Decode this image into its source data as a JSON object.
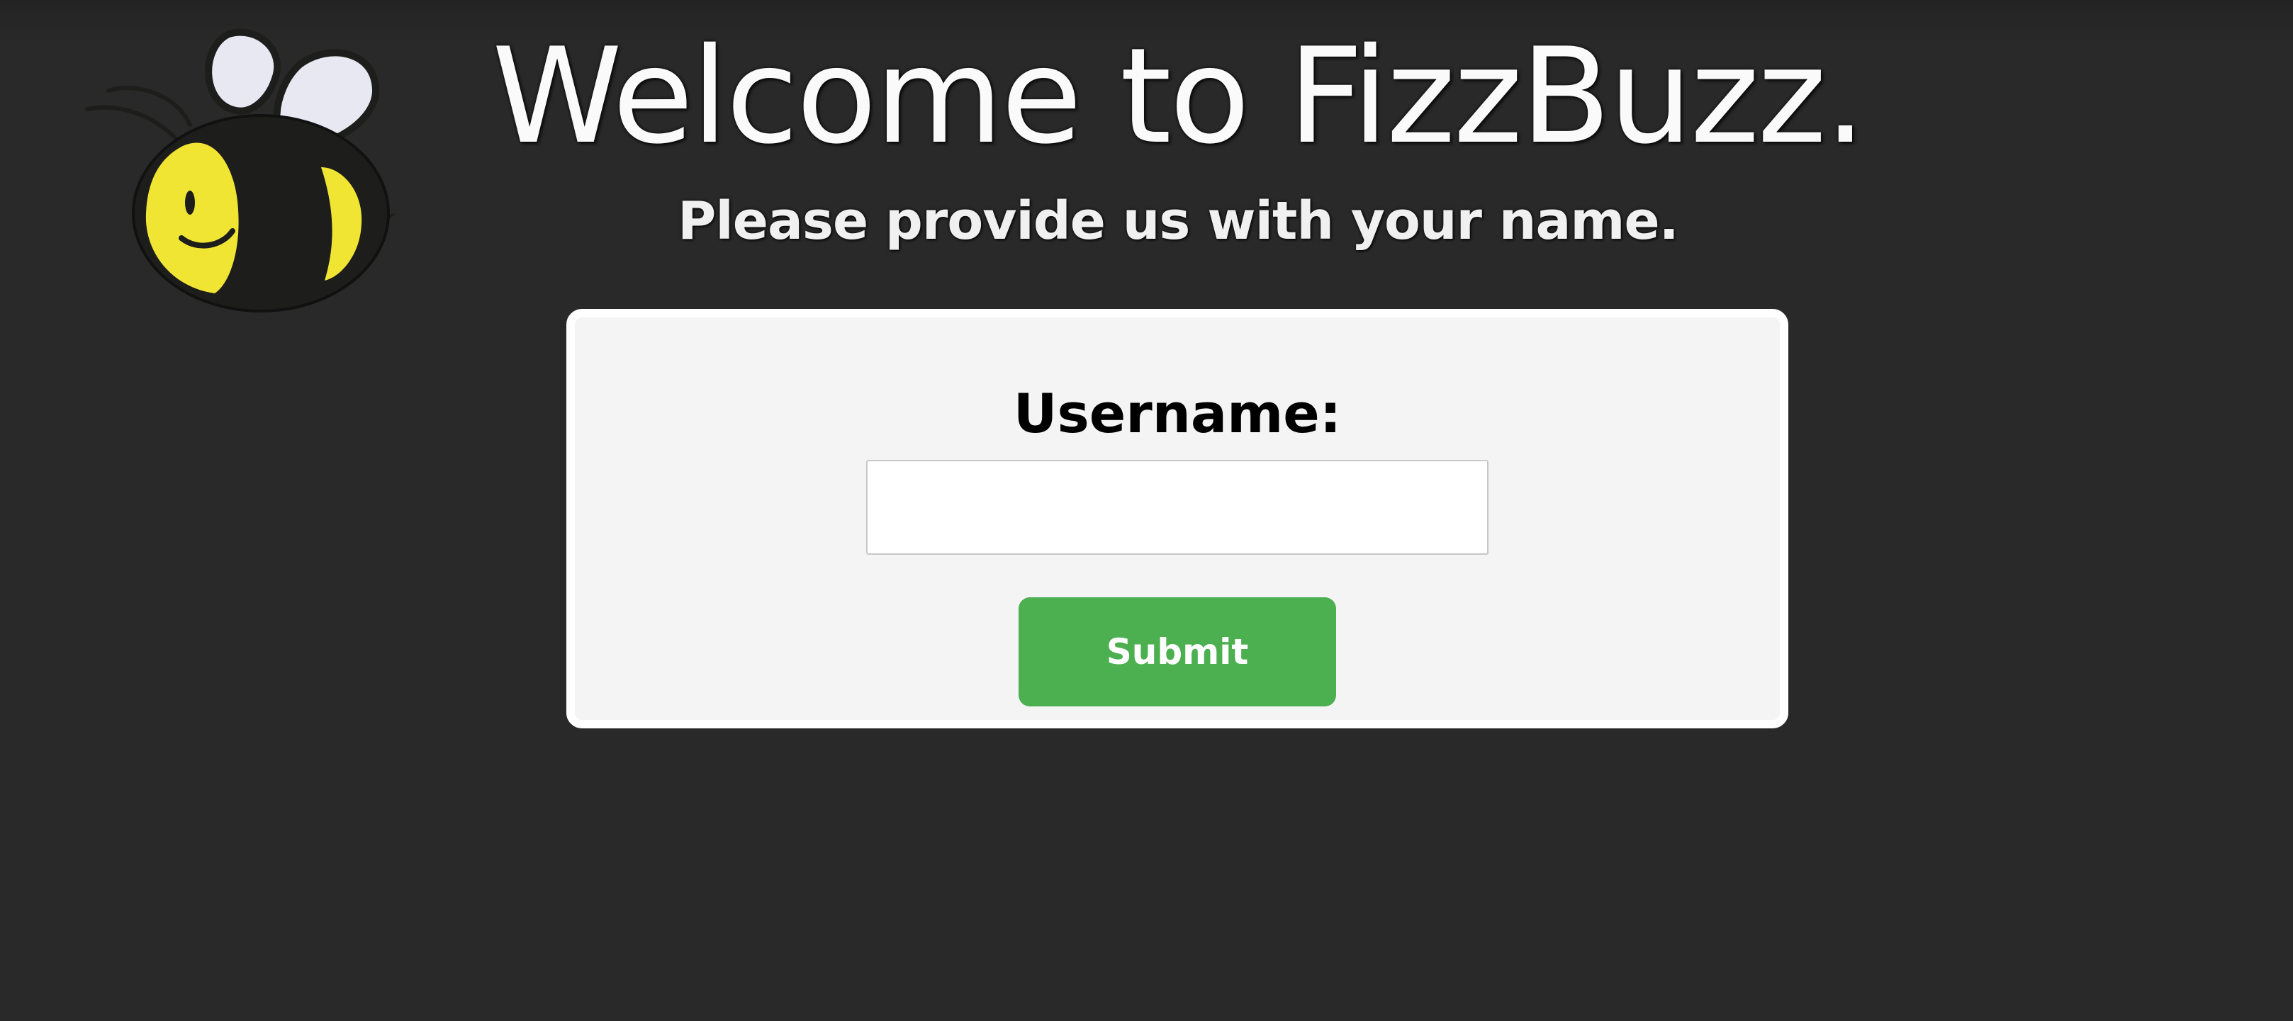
{
  "header": {
    "title": "Welcome to FizzBuzz.",
    "subtitle": "Please provide us with your name."
  },
  "logo": {
    "icon": "bee-icon",
    "colors": {
      "body": "#f1e534",
      "stripes": "#1d1d1b",
      "wings": "#e8e8f2"
    }
  },
  "form": {
    "username_label": "Username:",
    "username_value": "",
    "username_placeholder": "",
    "submit_label": "Submit"
  },
  "colors": {
    "background": "#292929",
    "card": "#f4f4f4",
    "submit": "#4caf50"
  }
}
